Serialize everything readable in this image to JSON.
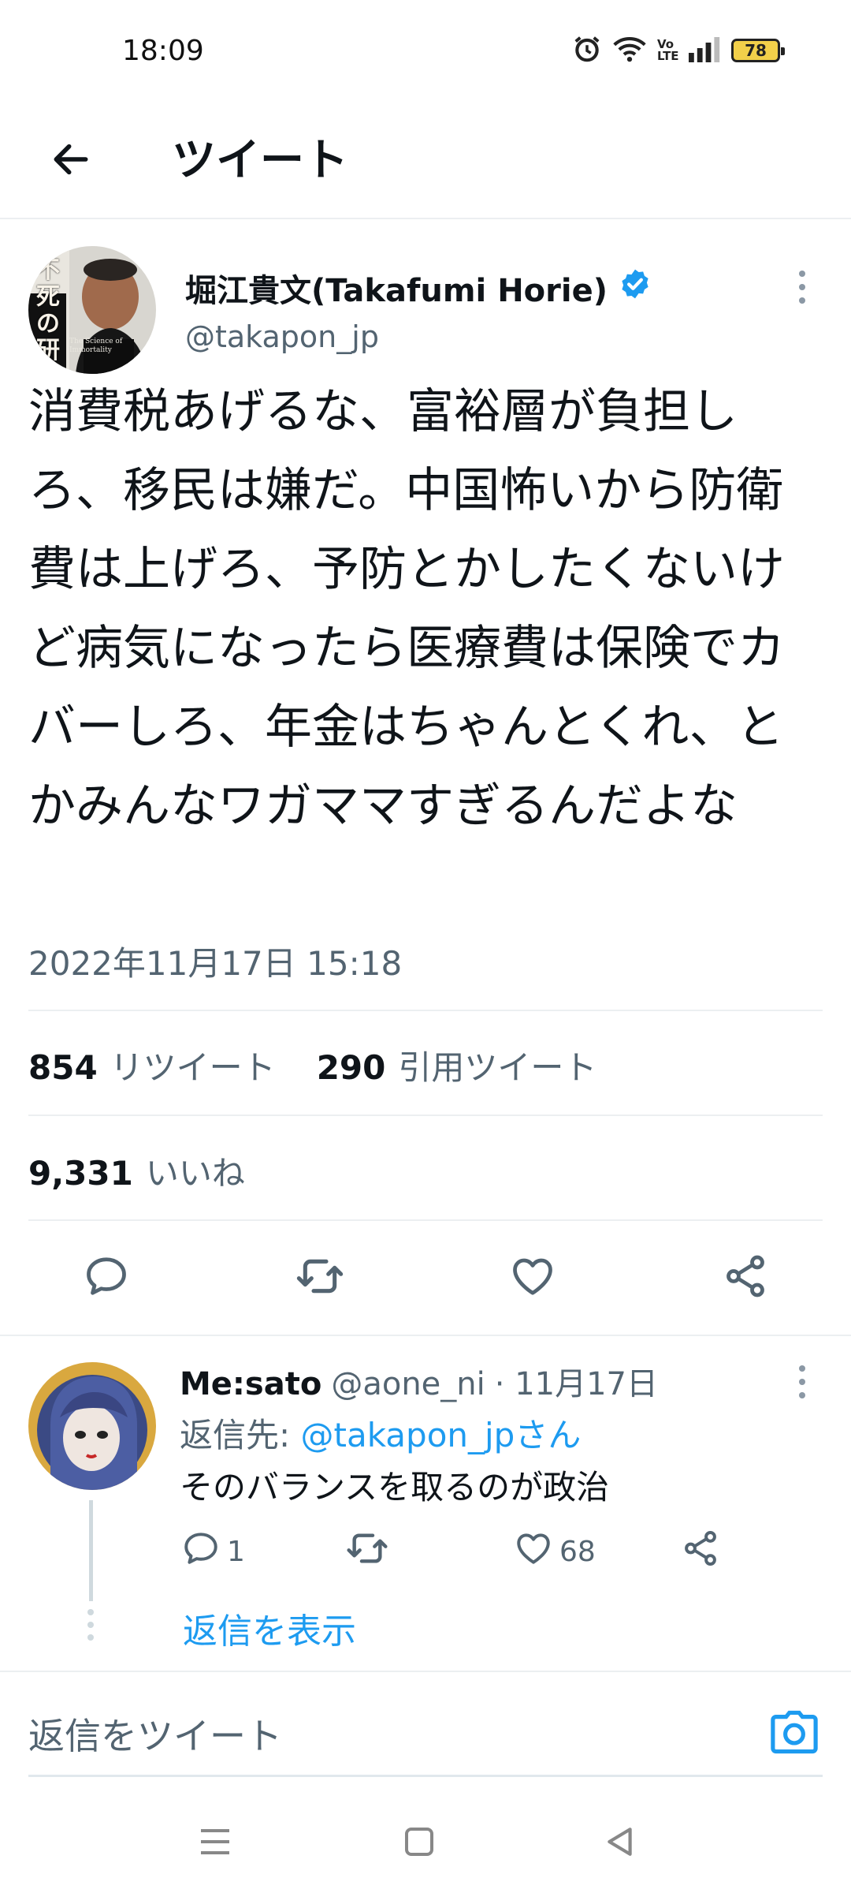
{
  "status_bar": {
    "time": "18:09",
    "battery": "78",
    "volte": "Vo LTE",
    "icons": [
      "alarm-icon",
      "wifi-icon",
      "volte-icon",
      "signal-icon",
      "battery-icon"
    ]
  },
  "header": {
    "title": "ツイート",
    "back_icon": "back-arrow-icon"
  },
  "tweet": {
    "author_name": "堀江貴文(Takafumi Horie)",
    "verified": true,
    "handle": "@takapon_jp",
    "avatar_cover": {
      "title": "不死の研究",
      "subtitle": "The Science of Immortality"
    },
    "text": "消費税あげるな、富裕層が負担しろ、移民は嫌だ。中国怖いから防衛費は上げろ、予防とかしたくないけど病気になったら医療費は保険でカバーしろ、年金はちゃんとくれ、とかみんなワガママすぎるんだよな",
    "timestamp": "2022年11月17日 15:18",
    "retweet_count": "854",
    "retweet_label": "リツイート",
    "quote_count": "290",
    "quote_label": "引用ツイート",
    "like_count": "9,331",
    "like_label": "いいね",
    "actions": [
      "reply-icon",
      "retweet-icon",
      "like-icon",
      "share-icon"
    ]
  },
  "reply": {
    "name": "Me:sato",
    "handle": "@aone_ni",
    "date": "· 11月17日",
    "replying_prefix": "返信先: ",
    "replying_to": "@takapon_jpさん",
    "text": "そのバランスを取るのが政治",
    "reply_count": "1",
    "like_count": "68",
    "show_replies": "返信を表示"
  },
  "composer": {
    "placeholder": "返信をツイート",
    "camera_icon": "camera-icon"
  },
  "nav_bar": {
    "icons": [
      "menu-icon",
      "home-square-icon",
      "back-triangle-icon"
    ]
  },
  "colors": {
    "accent": "#1d9bf0",
    "text": "#0f1419",
    "secondary": "#536471",
    "divider": "#eceff1"
  }
}
